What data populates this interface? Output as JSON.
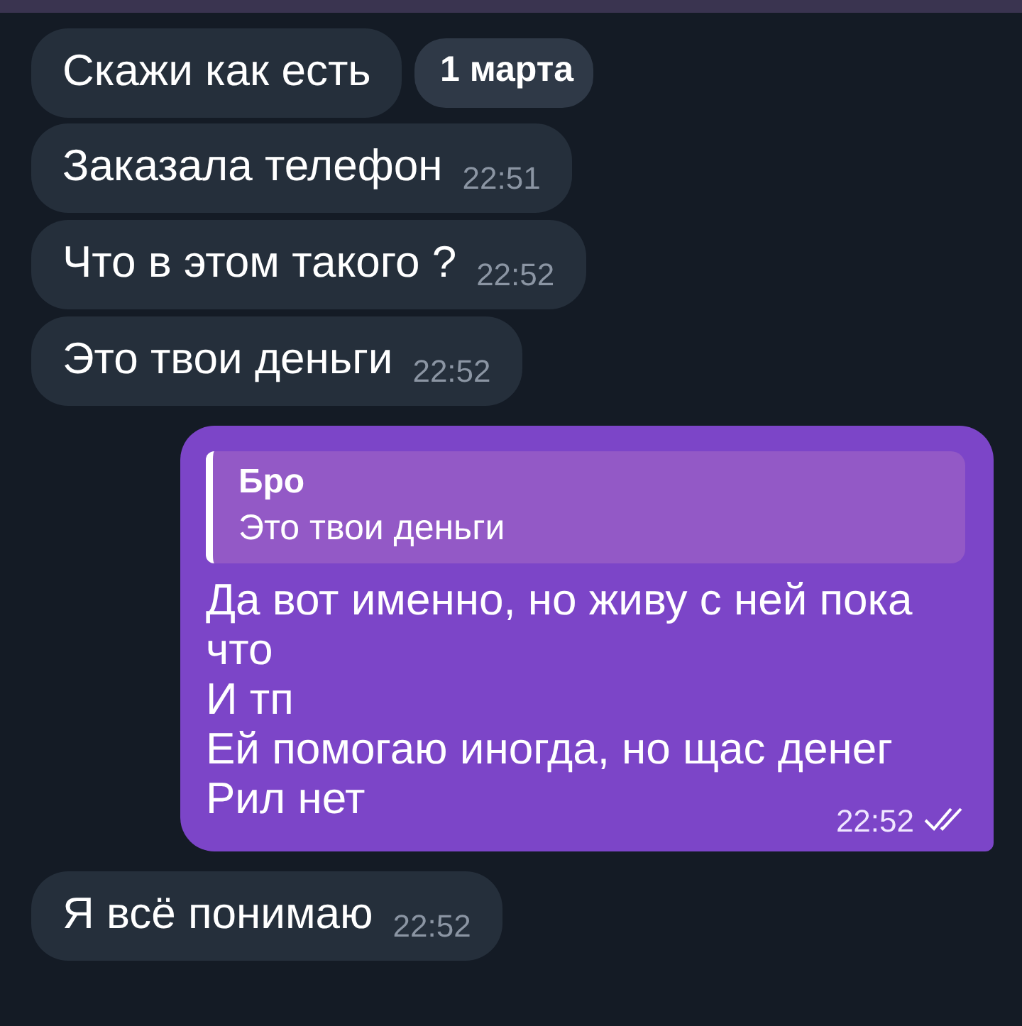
{
  "date_badge": "1 марта",
  "messages": [
    {
      "kind": "incoming",
      "text": "Скажи как есть"
    },
    {
      "kind": "incoming",
      "text": "Заказала телефон",
      "time": "22:51"
    },
    {
      "kind": "incoming",
      "text": "Что в этом такого ?",
      "time": "22:52"
    },
    {
      "kind": "incoming",
      "text": "Это твои деньги",
      "time": "22:52"
    },
    {
      "kind": "outgoing",
      "reply": {
        "author": "Бро",
        "text": "Это твои деньги"
      },
      "lines": [
        "Да вот именно, но живу с ней пока что",
        "И тп",
        "Ей помогаю иногда, но щас денег",
        "Рил нет"
      ],
      "time": "22:52",
      "read": true
    },
    {
      "kind": "incoming",
      "text": "Я всё понимаю",
      "time": "22:52"
    }
  ]
}
